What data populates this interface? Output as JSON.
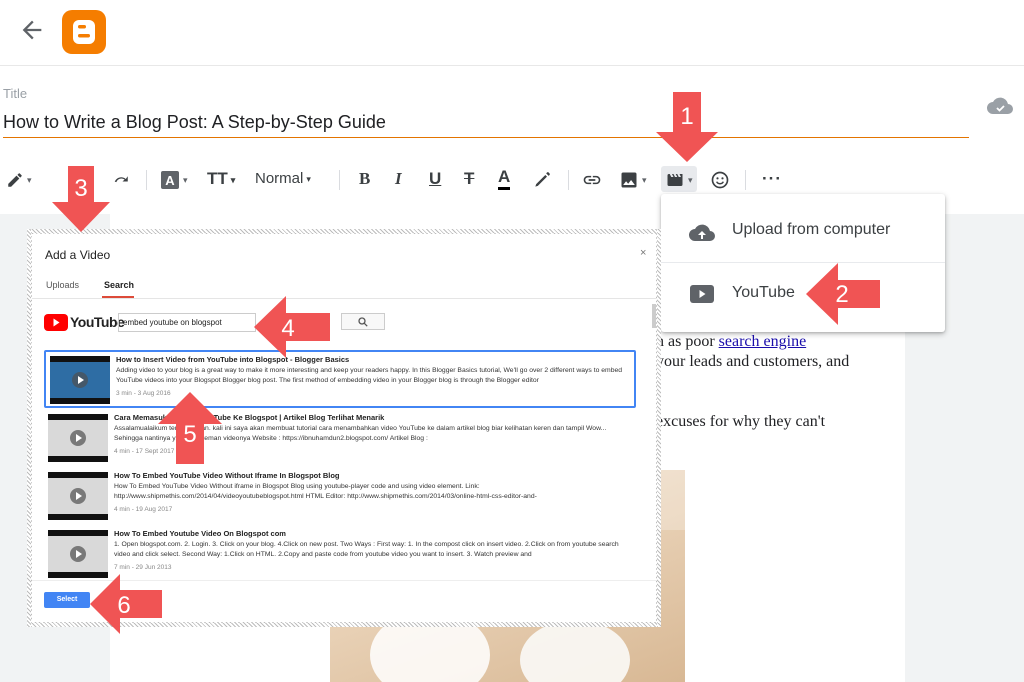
{
  "header": {
    "back_icon": "arrow-back-icon",
    "logo_icon": "blogger-logo-icon",
    "logo_color": "#f57d00"
  },
  "post": {
    "title_label": "Title",
    "title_value": "How to Write a Blog Post: A Step-by-Step Guide",
    "save_status_icon": "cloud-done-icon"
  },
  "toolbar": {
    "paragraph_style": "Normal",
    "bold": "B",
    "italic": "I",
    "underline": "U",
    "strikethrough": "T",
    "text_color": "A",
    "font_size": "TT"
  },
  "insert_menu": {
    "items": [
      {
        "label": "Upload from computer",
        "icon": "cloud-upload-icon"
      },
      {
        "label": "YouTube",
        "icon": "youtube-icon"
      }
    ]
  },
  "body": {
    "line1_prefix": "h as poor ",
    "line1_link": "search engine ",
    "line2": " your leads and customers, and",
    "line3": "excuses for why they can't"
  },
  "dialog": {
    "title": "Add a Video",
    "close": "×",
    "tabs": [
      "Uploads",
      "Search"
    ],
    "active_tab": "Search",
    "youtube_word": "YouTube",
    "search_value": "embed youtube on blogspot",
    "search_button_icon": "magnifier-icon",
    "select_label": "Select",
    "results": [
      {
        "title": "How to Insert Video from YouTube into Blogspot - Blogger Basics",
        "description": "Adding video to your blog is a great way to make it more interesting and keep your readers happy. In this Blogger Basics tutorial, We'll go over 2 different ways to embed YouTube videos into your Blogspot Blogger blog post. The first method of embedding video in your Blogger blog is through the Blogger editor",
        "meta": "3 min - 3 Aug 2016",
        "selected": true
      },
      {
        "title": "Cara Memasukan Video YouTube Ke Blogspot | Artikel Blog Terlihat Menarik",
        "description": "Assalamualaikum teman teman. kali ini saya akan membuat tutorial cara menambahkan video YouTube ke dalam artikel blog biar kelihatan keren dan tampil Wow... Sehingga nantinya ya teman-teman videonya Website : https://ibnuhamdun2.blogspot.com/ Artikel Blog :",
        "meta": "4 min - 17 Sept 2017",
        "selected": false
      },
      {
        "title": "How To Embed YouTube Video Without Iframe In Blogspot Blog",
        "description": "How To Embed YouTube Video Without iframe in Blogspot Blog using youtube-player code and using video element. Link: http://www.shipmethis.com/2014/04/videoyoutubeblogspot.html HTML Editor: http://www.shipmethis.com/2014/03/online-html-css-editor-and-",
        "meta": "4 min - 19 Aug 2017",
        "selected": false
      },
      {
        "title": "How To Embed Youtube Video On Blogspot com",
        "description": "1. Open blogspot.com. 2. Login. 3. Click on your blog. 4.Click on new post. Two Ways : First way: 1. In the compost click on insert video. 2.Click on from youtube search video and click select. Second Way: 1.Click on HTML. 2.Copy and paste code from youtube video you want to insert. 3. Watch preview and",
        "meta": "7 min - 29 Jun 2013",
        "selected": false
      }
    ]
  },
  "annotations": [
    "1",
    "2",
    "3",
    "4",
    "5",
    "6"
  ],
  "colors": {
    "accent_orange": "#e37400",
    "arrow_red": "#f05454",
    "select_blue": "#4285f4"
  }
}
